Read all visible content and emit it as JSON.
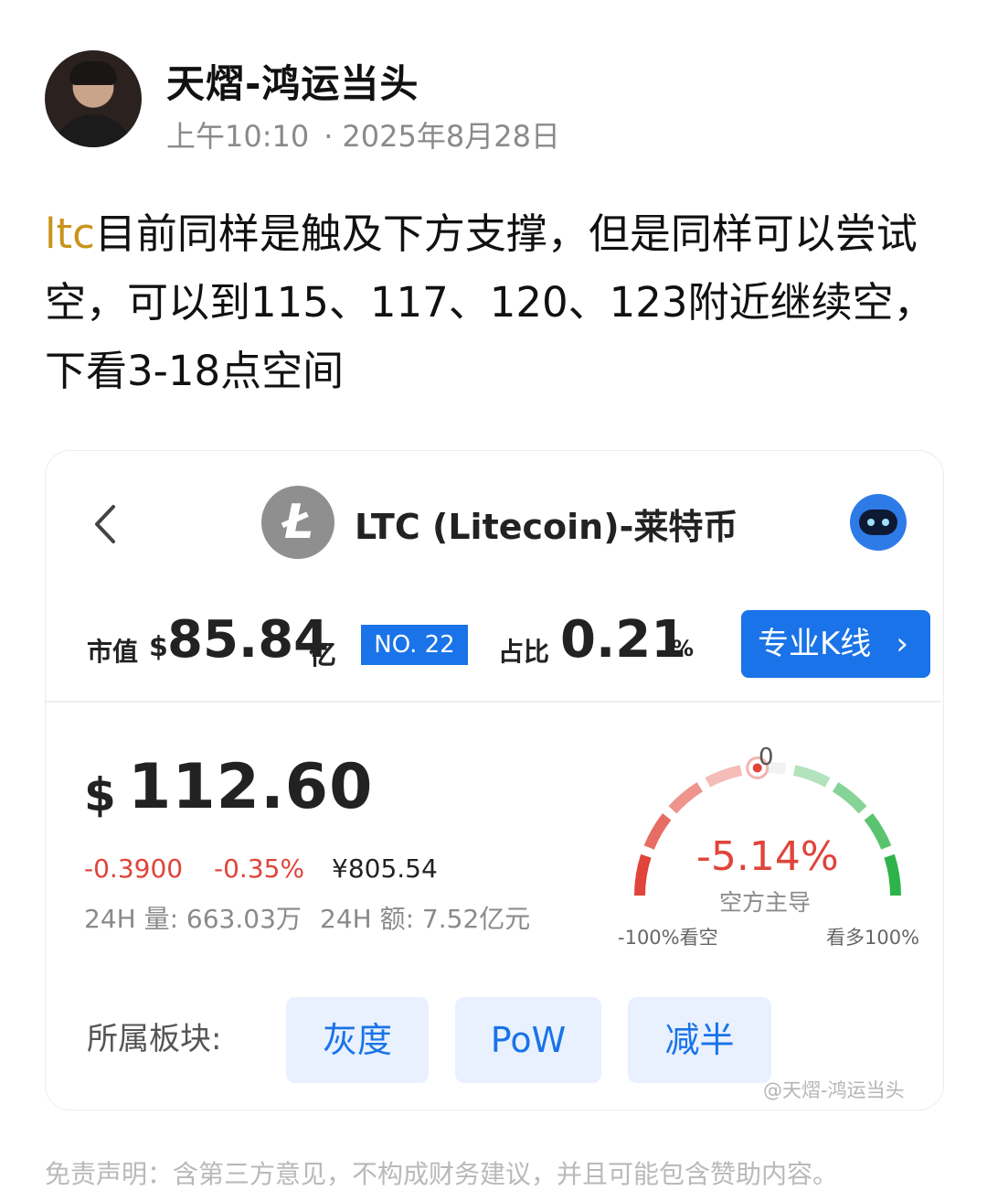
{
  "post": {
    "author": "天熠-鸿运当头",
    "time": "上午10:10",
    "date": "2025年8月28日",
    "tag": "ltc",
    "body": "目前同样是触及下方支撑，但是同样可以尝试空，可以到115、117、120、123附近继续空，下看3-18点空间"
  },
  "card": {
    "coin_symbol": "Ł",
    "coin_title": "LTC (Litecoin)-莱特币",
    "market_cap_label": "市值",
    "market_cap_currency": "$",
    "market_cap_value": "85.84",
    "market_cap_unit": "亿",
    "rank": "NO. 22",
    "share_label": "占比",
    "share_value": "0.21",
    "share_unit": "%",
    "kline_button": "专业K线",
    "kline_chevron": "›",
    "price_currency": "$",
    "price": "112.60",
    "change_abs": "-0.3900",
    "change_pct": "-0.35%",
    "price_cny": "¥805.54",
    "volume_label": "24H 量: 663.03万",
    "amount_label": "24H 额: 7.52亿元",
    "gauge": {
      "zero_label": "0",
      "value_text": "-5.14%",
      "value": -5.14,
      "status": "空方主导",
      "left_label": "-100%看空",
      "right_label": "看多100%",
      "bear_color": "#e0443a",
      "bull_color": "#2db34a"
    },
    "sector_label": "所属板块:",
    "sectors": [
      "灰度",
      "PoW",
      "减半"
    ],
    "watermark": "@天熠-鸿运当头"
  },
  "disclaimer": "免责声明：含第三方意见，不构成财务建议，并且可能包含赞助内容。",
  "colors": {
    "accent": "#1a73e8",
    "down": "#e0443a",
    "tag": "#c9941b"
  }
}
